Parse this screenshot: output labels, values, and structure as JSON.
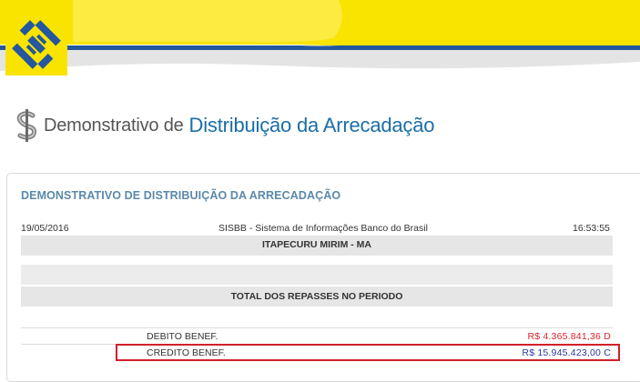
{
  "header": {
    "brand_colors": {
      "yellow": "#f9e400",
      "blue": "#24579f"
    },
    "logo_icon": "banco-do-brasil-logo"
  },
  "page_title": {
    "icon": "dollar-sign-icon",
    "prefix": "Demonstrativo de",
    "main": "Distribuição da Arrecadação"
  },
  "report": {
    "title": "DEMONSTRATIVO DE DISTRIBUIÇÃO DA ARRECADAÇÃO",
    "date": "19/05/2016",
    "system": "SISBB - Sistema de Informações Banco do Brasil",
    "time": "16:53:55",
    "municipality": "ITAPECURU MIRIM - MA",
    "section_title": "TOTAL DOS REPASSES NO PERIODO",
    "lines": [
      {
        "label": "DEBITO BENEF.",
        "value": "R$ 4.365.841,36 D",
        "color": "#d9252d"
      },
      {
        "label": "CREDITO BENEF.",
        "value": "R$ 15.945.423,00 C",
        "color": "#2a3b9c"
      }
    ]
  }
}
